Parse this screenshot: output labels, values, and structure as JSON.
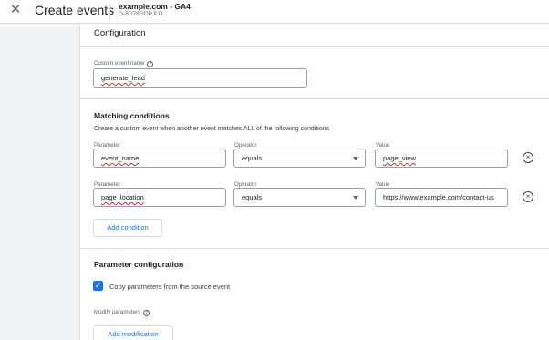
{
  "header": {
    "close_icon": "close-icon",
    "title": "Create events",
    "property_name": "example.com - GA4",
    "property_id": "G-8D78GDPJLD"
  },
  "configuration": {
    "title": "Configuration",
    "custom_event_name_label": "Custom event name",
    "custom_event_name_value": "generate_lead"
  },
  "matching": {
    "title": "Matching conditions",
    "description": "Create a custom event when another event matches ALL of the following conditions",
    "parameter_label": "Parameter",
    "operator_label": "Operator",
    "value_label": "Value",
    "conditions": [
      {
        "parameter": "event_name",
        "operator": "equals",
        "value": "page_view"
      },
      {
        "parameter": "page_location",
        "operator": "equals",
        "value": "https://www.example.com/contact-us"
      }
    ],
    "add_condition_label": "Add condition"
  },
  "parameter_config": {
    "title": "Parameter configuration",
    "copy_label": "Copy parameters from the source event",
    "copy_checked": true,
    "modify_label": "Modify parameters",
    "add_modification_label": "Add modification"
  },
  "colors": {
    "accent": "#1a73e8",
    "page_bg": "#f1f3f4",
    "spellcheck": "#d93025"
  }
}
